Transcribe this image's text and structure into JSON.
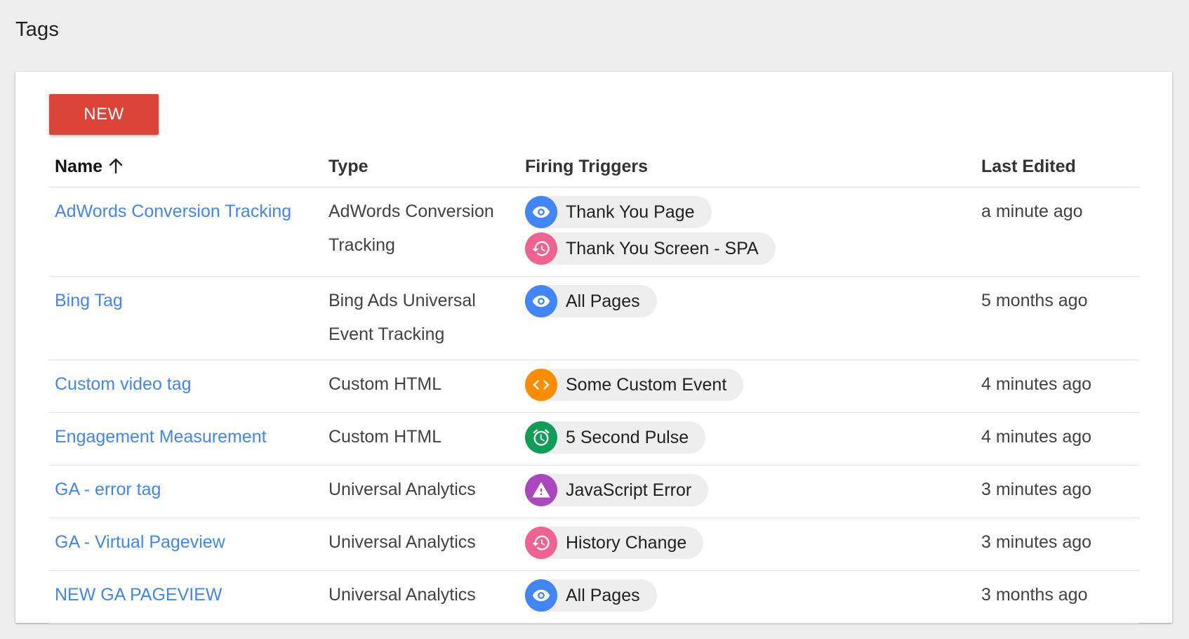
{
  "page_title": "Tags",
  "new_button_label": "NEW",
  "columns": {
    "name": "Name",
    "type": "Type",
    "triggers": "Firing Triggers",
    "last_edited": "Last Edited"
  },
  "sort": {
    "column": "Name",
    "direction": "ascending"
  },
  "icon_colors": {
    "eye-icon": "#4285f4",
    "history-icon": "#f06292",
    "code-icon": "#fb8c00",
    "alarm-icon": "#0f9d58",
    "warning-icon": "#ab47bc"
  },
  "link_color": "#4285f4",
  "new_button_color": "#db4437",
  "rows": [
    {
      "name": "AdWords Conversion Tracking",
      "type": "AdWords Conversion Tracking",
      "triggers": [
        {
          "label": "Thank You Page",
          "icon": "eye-icon"
        },
        {
          "label": "Thank You Screen - SPA",
          "icon": "history-icon"
        }
      ],
      "last_edited": "a minute ago"
    },
    {
      "name": "Bing Tag",
      "type": "Bing Ads Universal Event Tracking",
      "triggers": [
        {
          "label": "All Pages",
          "icon": "eye-icon"
        }
      ],
      "last_edited": "5 months ago"
    },
    {
      "name": "Custom video tag",
      "type": "Custom HTML",
      "triggers": [
        {
          "label": "Some Custom Event",
          "icon": "code-icon"
        }
      ],
      "last_edited": "4 minutes ago"
    },
    {
      "name": "Engagement Measurement",
      "type": "Custom HTML",
      "triggers": [
        {
          "label": "5 Second Pulse",
          "icon": "alarm-icon"
        }
      ],
      "last_edited": "4 minutes ago"
    },
    {
      "name": "GA - error tag",
      "type": "Universal Analytics",
      "triggers": [
        {
          "label": "JavaScript Error",
          "icon": "warning-icon"
        }
      ],
      "last_edited": "3 minutes ago"
    },
    {
      "name": "GA - Virtual Pageview",
      "type": "Universal Analytics",
      "triggers": [
        {
          "label": "History Change",
          "icon": "history-icon"
        }
      ],
      "last_edited": "3 minutes ago"
    },
    {
      "name": "NEW GA PAGEVIEW",
      "type": "Universal Analytics",
      "triggers": [
        {
          "label": "All Pages",
          "icon": "eye-icon"
        }
      ],
      "last_edited": "3 months ago"
    }
  ]
}
